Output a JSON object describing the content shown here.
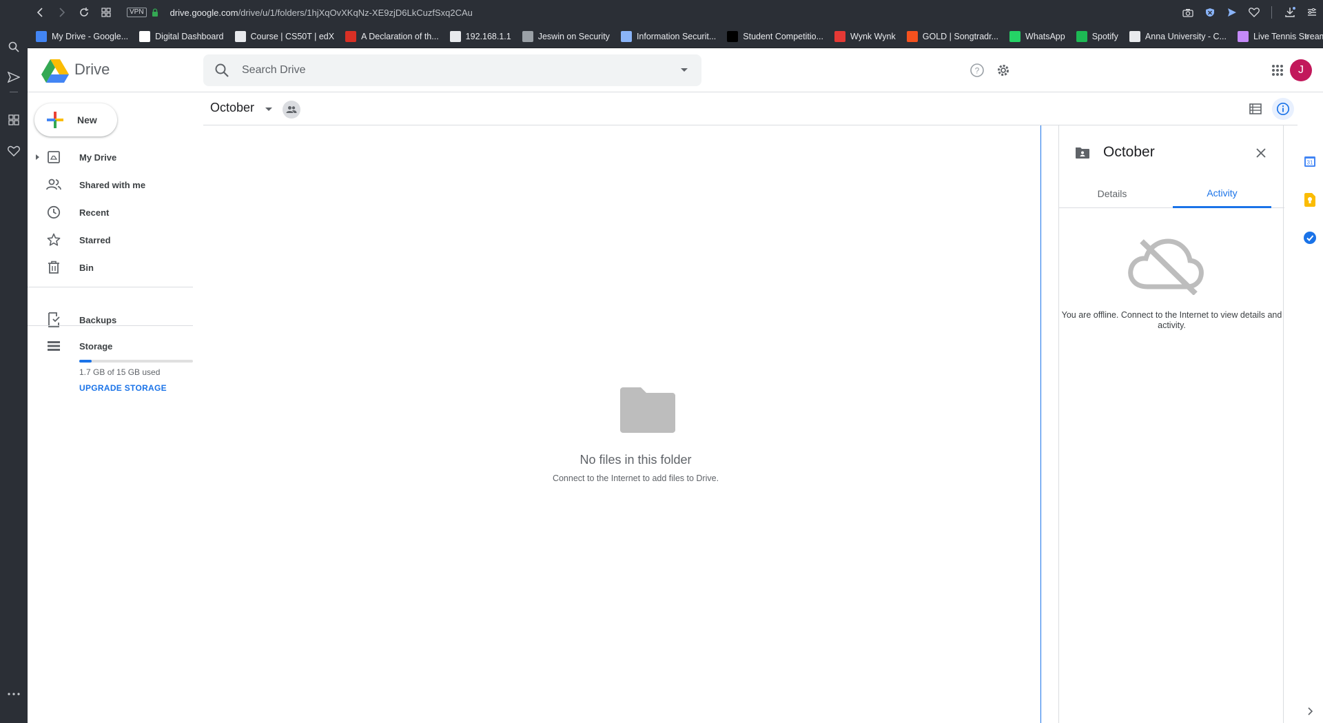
{
  "browser": {
    "url_host": "drive.google.com",
    "url_path": "/drive/u/1/folders/1hjXqOvXKqNz-XE9zjD6LkCuzfSxq2CAu",
    "vpn_label": "VPN",
    "bookmarks": [
      {
        "label": "My Drive - Google...",
        "color": "#4285f4"
      },
      {
        "label": "Digital Dashboard",
        "color": "#ffffff"
      },
      {
        "label": "Course | CS50T | edX",
        "color": "#e8eaed"
      },
      {
        "label": "A Declaration of th...",
        "color": "#d93025"
      },
      {
        "label": "192.168.1.1",
        "color": "#e8eaed"
      },
      {
        "label": "Jeswin on Security",
        "color": "#9aa0a6"
      },
      {
        "label": "Information Securit...",
        "color": "#8ab4f8"
      },
      {
        "label": "Student Competitio...",
        "color": "#000000"
      },
      {
        "label": "Wynk Wynk",
        "color": "#e53935"
      },
      {
        "label": "GOLD | Songtradr...",
        "color": "#f4511e"
      },
      {
        "label": "WhatsApp",
        "color": "#25d366"
      },
      {
        "label": "Spotify",
        "color": "#1db954"
      },
      {
        "label": "Anna University - C...",
        "color": "#e8eaed"
      },
      {
        "label": "Live Tennis Streami...",
        "color": "#c58af9"
      }
    ]
  },
  "header": {
    "brand": "Drive",
    "search_placeholder": "Search Drive",
    "avatar_initial": "J",
    "avatar_color": "#c2185b"
  },
  "sidebar": {
    "new_label": "New",
    "items": [
      {
        "label": "My Drive",
        "icon": "my-drive-icon"
      },
      {
        "label": "Shared with me",
        "icon": "shared-icon"
      },
      {
        "label": "Recent",
        "icon": "clock-icon"
      },
      {
        "label": "Starred",
        "icon": "star-icon"
      },
      {
        "label": "Bin",
        "icon": "trash-icon"
      }
    ],
    "backups_label": "Backups",
    "storage_label": "Storage",
    "storage_used_fraction": 0.11,
    "storage_text": "1.7 GB of 15 GB used",
    "upgrade_label": "UPGRADE STORAGE"
  },
  "main": {
    "folder_title": "October",
    "empty_title": "No files in this folder",
    "empty_subtitle": "Connect to the Internet to add files to Drive."
  },
  "details_panel": {
    "title": "October",
    "tabs": [
      {
        "label": "Details",
        "active": false
      },
      {
        "label": "Activity",
        "active": true
      }
    ],
    "offline_message": "You are offline. Connect to the Internet to view details and activity."
  },
  "colors": {
    "accent": "#1a73e8",
    "browser_chrome": "#2b2f36"
  }
}
